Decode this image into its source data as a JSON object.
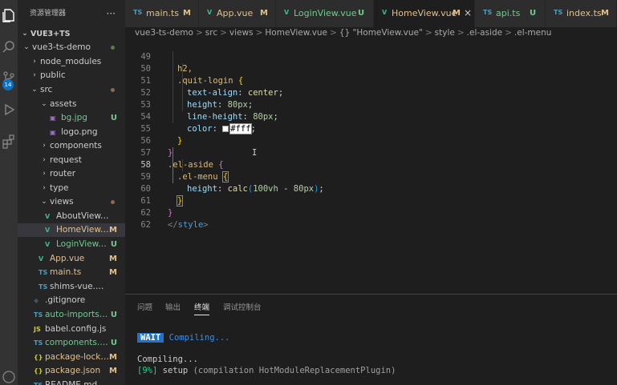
{
  "explorer": {
    "title": "资源管理器",
    "more": "···",
    "project": "VUE3+TS",
    "items": [
      {
        "label": "vue3-ts-demo",
        "kind": "folder-open",
        "status": ""
      },
      {
        "label": "node_modules",
        "kind": "folder",
        "status": ""
      },
      {
        "label": "public",
        "kind": "folder",
        "status": ""
      },
      {
        "label": "src",
        "kind": "folder-open",
        "status": ""
      },
      {
        "label": "assets",
        "kind": "folder-open",
        "status": ""
      },
      {
        "label": "bg.jpg",
        "kind": "image",
        "status": "U"
      },
      {
        "label": "logo.png",
        "kind": "image",
        "status": ""
      },
      {
        "label": "components",
        "kind": "folder",
        "status": ""
      },
      {
        "label": "request",
        "kind": "folder",
        "status": ""
      },
      {
        "label": "router",
        "kind": "folder",
        "status": ""
      },
      {
        "label": "type",
        "kind": "folder",
        "status": ""
      },
      {
        "label": "views",
        "kind": "folder-open",
        "status": ""
      },
      {
        "label": "AboutView.vue",
        "kind": "vue",
        "status": ""
      },
      {
        "label": "HomeView....",
        "kind": "vue",
        "status": "M"
      },
      {
        "label": "LoginView.vue",
        "kind": "vue",
        "status": "U"
      },
      {
        "label": "App.vue",
        "kind": "vue",
        "status": "M"
      },
      {
        "label": "main.ts",
        "kind": "ts",
        "status": "M"
      },
      {
        "label": "shims-vue.d.ts",
        "kind": "ts",
        "status": ""
      },
      {
        "label": ".gitignore",
        "kind": "git",
        "status": ""
      },
      {
        "label": "auto-imports.d.ts",
        "kind": "ts",
        "status": "U"
      },
      {
        "label": "babel.config.js",
        "kind": "js",
        "status": ""
      },
      {
        "label": "components.d.ts",
        "kind": "ts",
        "status": "U"
      },
      {
        "label": "package-lock.j...",
        "kind": "json",
        "status": "M"
      },
      {
        "label": "package.json",
        "kind": "json",
        "status": "M"
      },
      {
        "label": "README.md",
        "kind": "md",
        "status": ""
      }
    ]
  },
  "activity": {
    "badge": "14"
  },
  "tabs": [
    {
      "icon": "TS",
      "label": "main.ts",
      "status": "M"
    },
    {
      "icon": "V",
      "label": "App.vue",
      "status": "M"
    },
    {
      "icon": "V",
      "label": "LoginView.vue",
      "status": "U"
    },
    {
      "icon": "V",
      "label": "HomeView.vue",
      "status": "M",
      "close": "×"
    },
    {
      "icon": "TS",
      "label": "api.ts",
      "status": "U"
    },
    {
      "icon": "TS",
      "label": "index.ts",
      "status": "M"
    }
  ],
  "breadcrumb": {
    "parts": [
      "vue3-ts-demo",
      ">",
      "src",
      ">",
      "views",
      ">",
      "HomeView.vue",
      ">",
      "{} \"HomeView.vue\"",
      ">",
      "style",
      ">",
      ".el-aside",
      ">",
      ".el-menu"
    ]
  },
  "editor": {
    "lines": [
      {
        "n": "49",
        "t": "h2,"
      },
      {
        "n": "50",
        "t": ".quit-login {"
      },
      {
        "n": "51",
        "t": "text-align: center;"
      },
      {
        "n": "52",
        "t": "height: 80px;"
      },
      {
        "n": "53",
        "t": "line-height: 80px;"
      },
      {
        "n": "54",
        "t": "color: #fff;"
      },
      {
        "n": "55",
        "t": "}"
      },
      {
        "n": "56",
        "t": "}"
      },
      {
        "n": "57",
        "t": ".el-aside {"
      },
      {
        "n": "58",
        "t": ".el-menu {"
      },
      {
        "n": "59",
        "t": "height: calc(100vh - 80px);"
      },
      {
        "n": "60",
        "t": "}"
      },
      {
        "n": "61",
        "t": "}"
      },
      {
        "n": "62",
        "t": "</style>"
      }
    ]
  },
  "panel": {
    "tabs": [
      "问题",
      "输出",
      "终端",
      "调试控制台"
    ],
    "active_tab": "终端",
    "terminal": {
      "wait_badge": "WAIT",
      "wait_text": "Compiling...",
      "line2": "Compiling...",
      "progress_pct": "[9%]",
      "progress_step": "setup",
      "progress_detail": "(compilation HotModuleReplacementPlugin)"
    }
  },
  "colors": {
    "modified": "#e2c08d",
    "untracked": "#73c991",
    "vue": "#41b883",
    "ts": "#519aba",
    "accent": "#0e70c0"
  }
}
